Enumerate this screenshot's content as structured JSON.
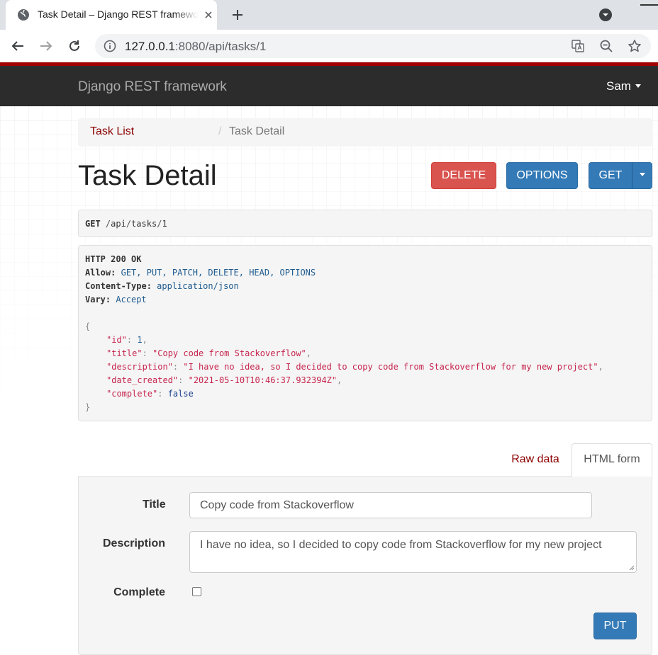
{
  "browser": {
    "tab_title": "Task Detail – Django REST framework",
    "url_host": "127.0.0.1",
    "url_rest": ":8080/api/tasks/1"
  },
  "navbar": {
    "brand": "Django REST framework",
    "user": "Sam"
  },
  "breadcrumb": {
    "link": "Task List",
    "separator": "/",
    "active": "Task Detail"
  },
  "page": {
    "title": "Task Detail"
  },
  "buttons": {
    "delete": "DELETE",
    "options": "OPTIONS",
    "get": "GET",
    "put": "PUT"
  },
  "request": {
    "method": "GET",
    "path_1": "/",
    "path_2": "api",
    "path_3": "/",
    "path_4": "tasks",
    "path_5": "/",
    "path_6": "1"
  },
  "response": {
    "status": "HTTP 200 OK",
    "allow_key": "Allow:",
    "allow_value": "GET, PUT, PATCH, DELETE, HEAD, OPTIONS",
    "ctype_key": "Content-Type:",
    "ctype_value": "application/json",
    "vary_key": "Vary:",
    "vary_value": "Accept",
    "open_brace": "{",
    "close_brace": "}",
    "id_key": "\"id\"",
    "id_value": "1",
    "title_key": "\"title\"",
    "title_value": "\"Copy code from Stackoverflow\"",
    "description_key": "\"description\"",
    "description_value": "\"I have no idea, so I decided to copy code from Stackoverflow for my new project\"",
    "date_key": "\"date_created\"",
    "date_value": "\"2021-05-10T10:46:37.932394Z\"",
    "complete_key": "\"complete\"",
    "complete_value": "false",
    "colon": ": ",
    "comma": ","
  },
  "tabs": {
    "raw": "Raw data",
    "html": "HTML form"
  },
  "form": {
    "title_label": "Title",
    "title_value": "Copy code from Stackoverflow",
    "description_label": "Description",
    "description_value": "I have no idea, so I decided to copy code from Stackoverflow for my new project",
    "complete_label": "Complete",
    "complete_checked": false
  },
  "colors": {
    "accent_red": "#a30000",
    "link_red": "#8b0000",
    "primary_blue": "#337ab7",
    "danger_red": "#d9534f",
    "navbar_bg": "#2c2c2c"
  }
}
